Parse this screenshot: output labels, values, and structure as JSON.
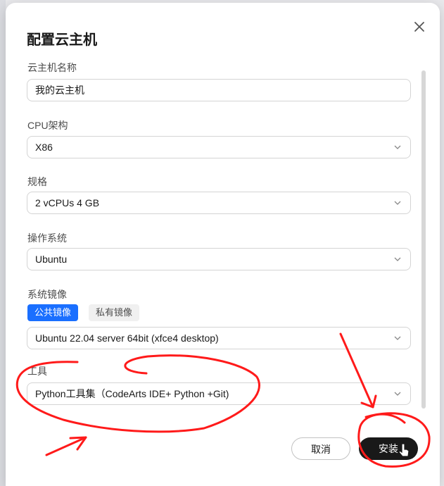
{
  "dialog": {
    "title": "配置云主机",
    "close_icon": "close-icon"
  },
  "form": {
    "name": {
      "label": "云主机名称",
      "value": "我的云主机"
    },
    "cpu_arch": {
      "label": "CPU架构",
      "value": "X86"
    },
    "spec": {
      "label": "规格",
      "value": "2 vCPUs 4 GB"
    },
    "os": {
      "label": "操作系统",
      "value": "Ubuntu"
    },
    "image": {
      "label": "系统镜像",
      "tabs": [
        "公共镜像",
        "私有镜像"
      ],
      "active_tab": "公共镜像",
      "value": "Ubuntu 22.04 server 64bit (xfce4 desktop)"
    },
    "tools": {
      "label": "工具",
      "value": "Python工具集（CodeArts IDE+ Python +Git)"
    }
  },
  "footer": {
    "cancel_label": "取消",
    "install_label": "安装"
  },
  "colors": {
    "accent": "#1a6fff",
    "primary_button": "#191919",
    "annotation": "#ff1a1a"
  }
}
